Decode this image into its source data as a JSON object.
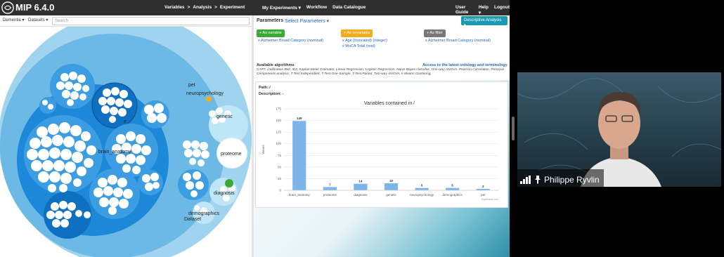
{
  "app": {
    "title": "MIP 6.4.0"
  },
  "nav": {
    "center": [
      "Variables",
      ">",
      "Analysis",
      ">",
      "Experiment"
    ],
    "mid": [
      "My Experiments ▾",
      "Workflow",
      "Data Catalogue"
    ],
    "right": [
      "User Guide",
      "Help ▾",
      "Logout"
    ]
  },
  "toolbar": {
    "dementia": "Dementia ▾",
    "datasets": "Datasets ▾",
    "search_placeholder": "Search"
  },
  "bubbles": {
    "labels": [
      "pet",
      "neuropsychology",
      "genetic",
      "brain_anatomy",
      "proteome",
      "diagnosis",
      "demographics",
      "Dataset",
      "e"
    ]
  },
  "parameters": {
    "title": "Parameters",
    "select_link": "Select Parameters ▾",
    "descriptive_button": "Descriptive Analysis ▸",
    "variable_button": "+ As variable",
    "covariable_button": "+ As covariable",
    "filter_button": "+ As filter",
    "variables": [
      "x Alzheimer Broad Category (nominal)"
    ],
    "covariables": [
      "x Age (truncated) (integer)",
      "x MoCA Total (real)"
    ],
    "filters": [
      "x Alzheimer Broad Category (nominal)"
    ],
    "algo_title": "Available algorithms",
    "algo_link": "Access to the latest ontology and terminology",
    "algorithms": "CART, Calibration Belt, ID3, Kaplan-Meier Estimator, Linear Regression, Logistic Regression, Naive Bayes classifier, One-way ANOVA, Pearson Correlation, Principal Components analysis, T-Test Independent, T-Test One-Sample, T-Test Paired, Two-way ANOVA, k-Means Clustering,"
  },
  "details": {
    "path": "Path: /",
    "description": "Description: -"
  },
  "chart_data": {
    "type": "bar",
    "title": "Variables contained in /",
    "ylabel": "Values",
    "xlabel": "",
    "categories": [
      "brain_anatomy",
      "proteome",
      "diagnosis",
      "genetic",
      "neuropsychology",
      "demographics",
      "pet"
    ],
    "values": [
      149,
      7,
      14,
      15,
      5,
      5,
      3
    ],
    "ylim": [
      0,
      175
    ],
    "yticks": [
      0,
      25,
      50,
      75,
      100,
      125,
      150,
      175
    ],
    "credit": "Highcharts.com",
    "color": "#7cb5ec"
  },
  "video": {
    "name": "Philippe Ryvlin"
  },
  "colors": {
    "accent": "#1a9ab0",
    "variable": "#3aaa35",
    "covariable": "#f0ad1e",
    "filter": "#777777"
  }
}
